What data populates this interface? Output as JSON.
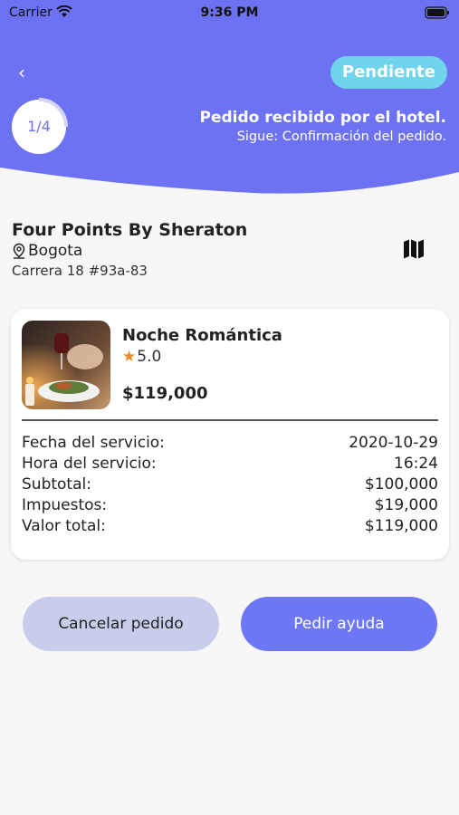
{
  "status_bar": {
    "carrier": "Carrier",
    "time": "9:36 PM"
  },
  "header": {
    "badge": "Pendiente",
    "step_label": "1/4",
    "step_progress": 0.25,
    "step_title": "Pedido recibido por el hotel.",
    "next_step": "Sigue: Confirmación del pedido.",
    "accent": "#6c72f2",
    "badge_color": "#6fd4ec"
  },
  "hotel": {
    "name": "Four Points By Sheraton",
    "city": "Bogota",
    "address": "Carrera 18 #93a-83"
  },
  "package": {
    "name": "Noche Romántica",
    "rating": "5.0",
    "price": "$119,000"
  },
  "details": [
    {
      "label": "Fecha del servicio:",
      "value": "2020-10-29"
    },
    {
      "label": "Hora del servicio:",
      "value": "16:24"
    },
    {
      "label": "Subtotal:",
      "value": "$100,000"
    },
    {
      "label": "Impuestos:",
      "value": "$19,000"
    },
    {
      "label": "Valor total:",
      "value": "$119,000"
    }
  ],
  "actions": {
    "cancel": "Cancelar pedido",
    "help": "Pedir ayuda"
  },
  "icons": [
    "back-icon",
    "wifi-icon",
    "battery-icon",
    "pin-icon",
    "map-icon",
    "star-icon"
  ]
}
